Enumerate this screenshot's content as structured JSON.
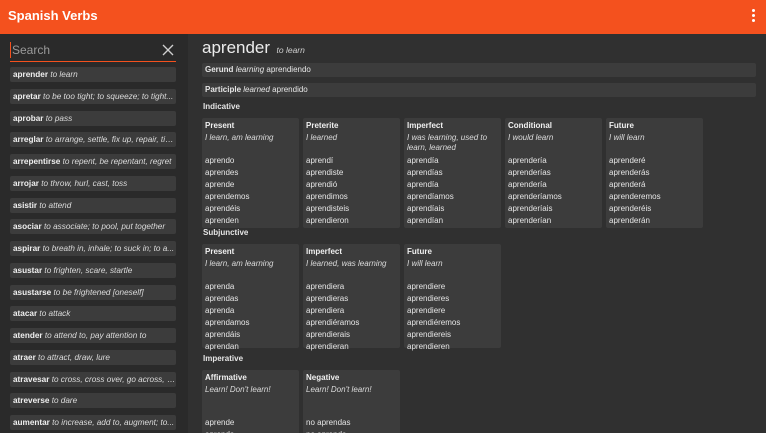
{
  "app": {
    "title": "Spanish Verbs"
  },
  "search": {
    "placeholder": "Search"
  },
  "verb_list": [
    {
      "verb": "aprender",
      "meaning": "to learn"
    },
    {
      "verb": "apretar",
      "meaning": "to be too tight; to squeeze; to tight..."
    },
    {
      "verb": "aprobar",
      "meaning": "to pass"
    },
    {
      "verb": "arreglar",
      "meaning": "to arrange, settle, fix up, repair, tid..."
    },
    {
      "verb": "arrepentirse",
      "meaning": "to repent, be repentant, regret"
    },
    {
      "verb": "arrojar",
      "meaning": "to throw, hurl, cast, toss"
    },
    {
      "verb": "asistir",
      "meaning": "to attend"
    },
    {
      "verb": "asociar",
      "meaning": "to associate; to pool, put together"
    },
    {
      "verb": "aspirar",
      "meaning": "to breath in, inhale; to suck in; to a..."
    },
    {
      "verb": "asustar",
      "meaning": "to frighten, scare, startle"
    },
    {
      "verb": "asustarse",
      "meaning": "to be frightened [oneself]"
    },
    {
      "verb": "atacar",
      "meaning": "to attack"
    },
    {
      "verb": "atender",
      "meaning": "to attend to, pay attention to"
    },
    {
      "verb": "atraer",
      "meaning": "to attract, draw, lure"
    },
    {
      "verb": "atravesar",
      "meaning": "to cross, cross over, go across, g..."
    },
    {
      "verb": "atreverse",
      "meaning": "to dare"
    },
    {
      "verb": "aumentar",
      "meaning": "to increase, add to, augment; to..."
    }
  ],
  "detail": {
    "infinitive": "aprender",
    "translation": "to learn",
    "gerund": {
      "label": "Gerund",
      "meaning": "learning",
      "form": "aprendiendo"
    },
    "participle": {
      "label": "Participle",
      "meaning": "learned",
      "form": "aprendido"
    },
    "indicative": {
      "title": "Indicative",
      "tenses": [
        {
          "name": "Present",
          "meaning": "I learn, am learning",
          "forms": [
            "aprendo",
            "aprendes",
            "aprende",
            "aprendemos",
            "aprendéis",
            "aprenden"
          ]
        },
        {
          "name": "Preterite",
          "meaning": "I learned",
          "forms": [
            "aprendí",
            "aprendiste",
            "aprendió",
            "aprendimos",
            "aprendisteis",
            "aprendieron"
          ]
        },
        {
          "name": "Imperfect",
          "meaning": "I was learning, used to learn, learned",
          "forms": [
            "aprendía",
            "aprendías",
            "aprendía",
            "aprendíamos",
            "aprendíais",
            "aprendían"
          ]
        },
        {
          "name": "Conditional",
          "meaning": "I would learn",
          "forms": [
            "aprendería",
            "aprenderías",
            "aprendería",
            "aprenderíamos",
            "aprenderíais",
            "aprenderían"
          ]
        },
        {
          "name": "Future",
          "meaning": "I will learn",
          "forms": [
            "aprenderé",
            "aprenderás",
            "aprenderá",
            "aprenderemos",
            "aprenderéis",
            "aprenderán"
          ]
        }
      ]
    },
    "subjunctive": {
      "title": "Subjunctive",
      "tenses": [
        {
          "name": "Present",
          "meaning": "I learn, am learning",
          "forms": [
            "aprenda",
            "aprendas",
            "aprenda",
            "aprendamos",
            "aprendáis",
            "aprendan"
          ]
        },
        {
          "name": "Imperfect",
          "meaning": "I learned, was learning",
          "forms": [
            "aprendiera",
            "aprendieras",
            "aprendiera",
            "aprendiéramos",
            "aprendierais",
            "aprendieran"
          ]
        },
        {
          "name": "Future",
          "meaning": "I will learn",
          "forms": [
            "aprendiere",
            "aprendieres",
            "aprendiere",
            "aprendiéremos",
            "aprendiereis",
            "aprendieren"
          ]
        }
      ]
    },
    "imperative": {
      "title": "Imperative",
      "tenses": [
        {
          "name": "Affirmative",
          "meaning": "Learn! Don't learn!",
          "forms": [
            "aprende",
            "aprenda"
          ]
        },
        {
          "name": "Negative",
          "meaning": "Learn! Don't learn!",
          "forms": [
            "no aprendas",
            "no aprenda"
          ]
        }
      ]
    }
  },
  "icons": {
    "menu": "more-vert-icon",
    "clear": "close-icon"
  },
  "colors": {
    "accent": "#f4511e",
    "background": "#303030",
    "card": "#3c3c3c"
  }
}
